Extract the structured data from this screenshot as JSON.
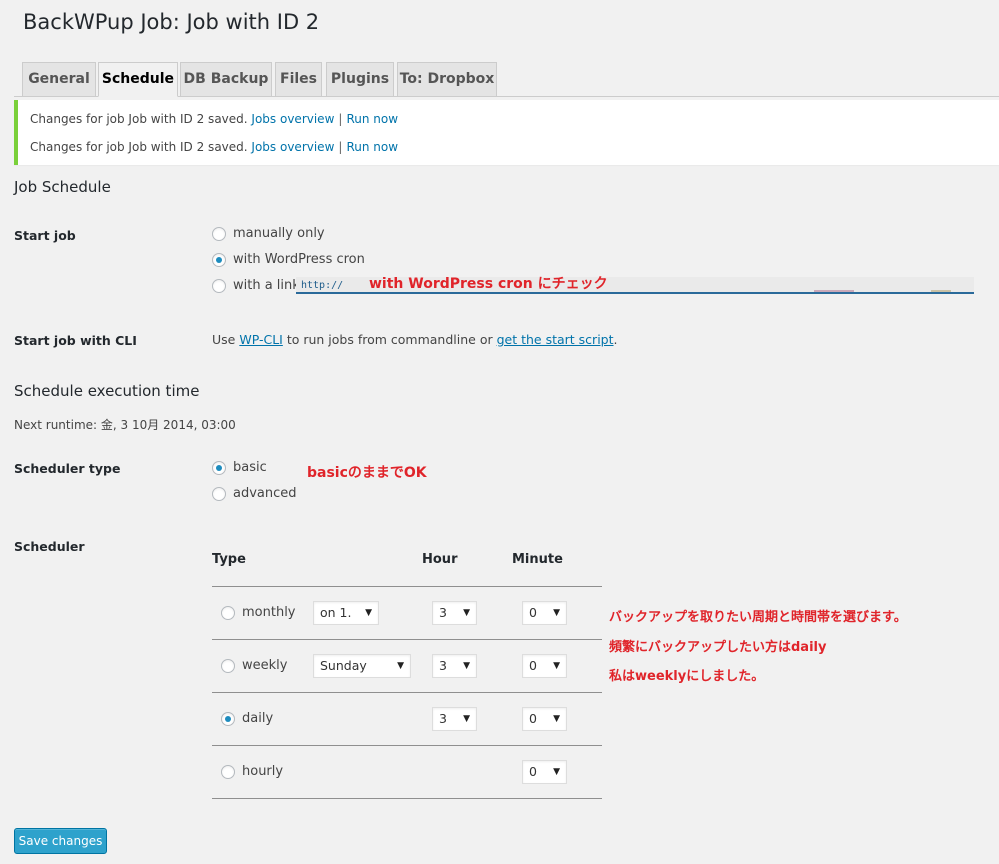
{
  "page": {
    "title": "BackWPup Job: Job with ID 2"
  },
  "tabs": [
    {
      "label": "General"
    },
    {
      "label": "Schedule"
    },
    {
      "label": "DB Backup"
    },
    {
      "label": "Files"
    },
    {
      "label": "Plugins"
    },
    {
      "label": "To: Dropbox"
    }
  ],
  "notices": [
    {
      "text": "Changes for job Job with ID 2 saved.",
      "link1": "Jobs overview",
      "sep": "|",
      "link2": "Run now"
    },
    {
      "text": "Changes for job Job with ID 2 saved.",
      "link1": "Jobs overview",
      "sep": "|",
      "link2": "Run now"
    }
  ],
  "job_schedule": {
    "title": "Job Schedule",
    "start_job_label": "Start job",
    "options": {
      "manual": "manually only",
      "cron": "with WordPress cron",
      "link": "with a link"
    },
    "selected": "with WordPress cron",
    "link_url": "http://"
  },
  "cli": {
    "label": "Start job with CLI",
    "prefix": "Use ",
    "link1": "WP-CLI",
    "middle": " to run jobs from commandline or ",
    "link2": "get the start script",
    "suffix": "."
  },
  "execution": {
    "title": "Schedule execution time",
    "next_runtime": "Next runtime: 金, 3 10月 2014, 03:00",
    "scheduler_type_label": "Scheduler type",
    "type_options": {
      "basic": "basic",
      "advanced": "advanced"
    },
    "type_selected": "basic"
  },
  "scheduler": {
    "label": "Scheduler",
    "headers": {
      "type": "Type",
      "hour": "Hour",
      "minute": "Minute"
    },
    "rows": {
      "monthly": {
        "label": "monthly",
        "day": "on 1.",
        "hour": "3",
        "minute": "0"
      },
      "weekly": {
        "label": "weekly",
        "day": "Sunday",
        "hour": "3",
        "minute": "0"
      },
      "daily": {
        "label": "daily",
        "hour": "3",
        "minute": "0"
      },
      "hourly": {
        "label": "hourly",
        "minute": "0"
      }
    },
    "selected": "daily"
  },
  "annotations": {
    "cron_note": "with WordPress cron にチェック",
    "basic_note": "basicのままでOK",
    "scheduler_note_1": "バックアップを取りたい周期と時間帯を選びます。",
    "scheduler_note_2": "頻繁にバックアップしたい方はdaily",
    "scheduler_note_3": "私はweeklyにしました。"
  },
  "save_button": "Save changes",
  "colors": {
    "accent": "#1e8cbe",
    "notice_border": "#7ad03a",
    "annotation": "#e0242a",
    "button": "#2ea2cc"
  }
}
